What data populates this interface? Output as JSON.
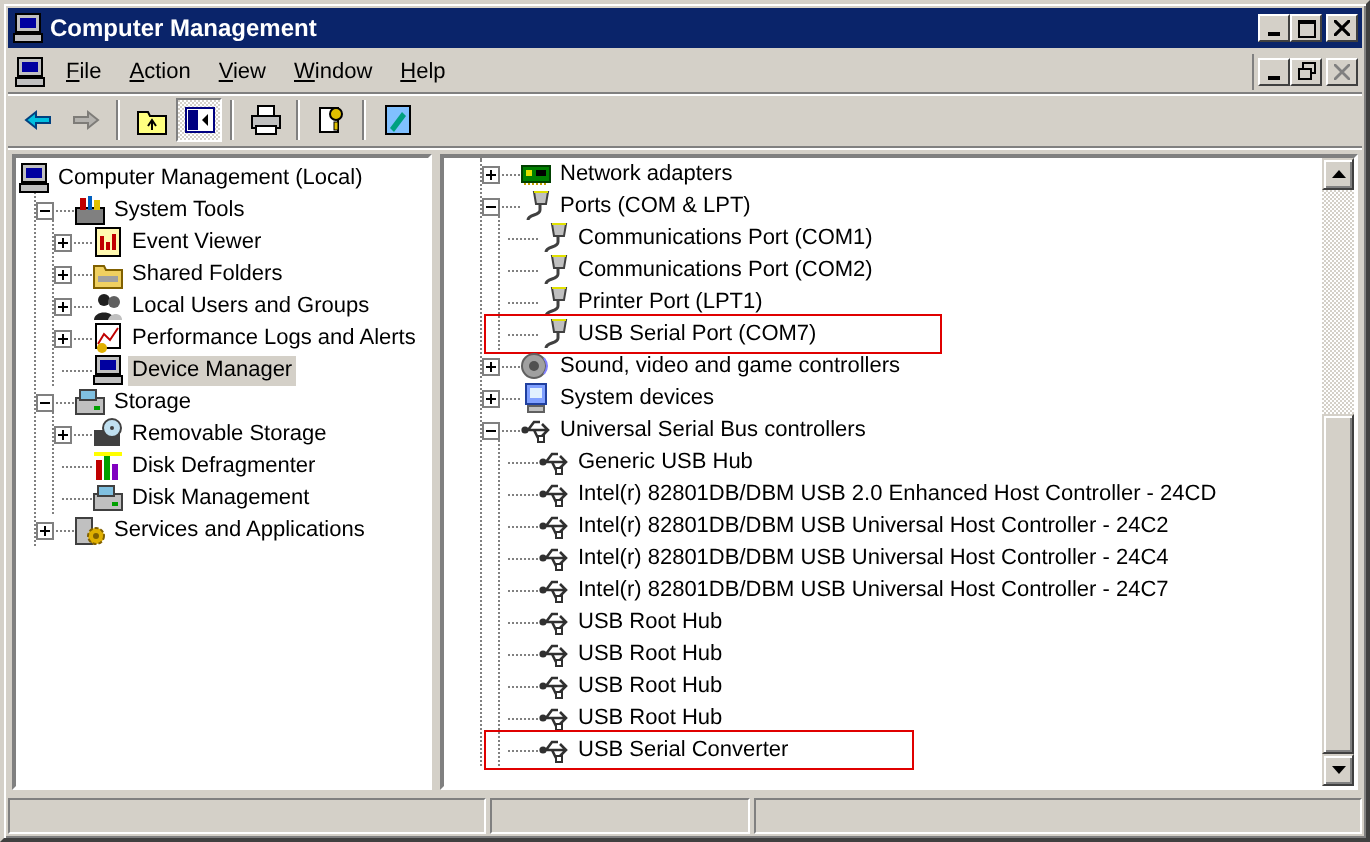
{
  "window": {
    "title": "Computer Management"
  },
  "menu": [
    {
      "label": "File"
    },
    {
      "label": "Action"
    },
    {
      "label": "View"
    },
    {
      "label": "Window"
    },
    {
      "label": "Help"
    }
  ],
  "toolbar": [
    {
      "kind": "back",
      "disabled": false,
      "pressed": false
    },
    {
      "kind": "forward",
      "disabled": true,
      "pressed": false
    },
    {
      "kind": "separator"
    },
    {
      "kind": "up",
      "disabled": false,
      "pressed": false
    },
    {
      "kind": "tree",
      "disabled": false,
      "pressed": true
    },
    {
      "kind": "separator"
    },
    {
      "kind": "print",
      "disabled": false,
      "pressed": false
    },
    {
      "kind": "separator"
    },
    {
      "kind": "help",
      "disabled": false,
      "pressed": false
    },
    {
      "kind": "separator"
    },
    {
      "kind": "console",
      "disabled": false,
      "pressed": false
    }
  ],
  "left_tree": {
    "items": [
      {
        "label": "Computer Management (Local)",
        "kind": "computer",
        "selected": false,
        "children": [
          {
            "label": "System Tools",
            "kind": "tools",
            "expanded": true,
            "selected": false,
            "children": [
              {
                "label": "Event Viewer",
                "kind": "log",
                "expanded": false,
                "selected": false
              },
              {
                "label": "Shared Folders",
                "kind": "folder",
                "expanded": false,
                "selected": false
              },
              {
                "label": "Local Users and Groups",
                "kind": "users",
                "expanded": false,
                "selected": false
              },
              {
                "label": "Performance Logs and Alerts",
                "kind": "chart",
                "expanded": false,
                "selected": false
              },
              {
                "label": "Device Manager",
                "kind": "computer",
                "selected": true
              }
            ]
          },
          {
            "label": "Storage",
            "kind": "drive",
            "expanded": true,
            "selected": false,
            "children": [
              {
                "label": "Removable Storage",
                "kind": "disc",
                "expanded": false,
                "selected": false
              },
              {
                "label": "Disk Defragmenter",
                "kind": "bars",
                "selected": false
              },
              {
                "label": "Disk Management",
                "kind": "drive",
                "selected": false
              }
            ]
          },
          {
            "label": "Services and Applications",
            "kind": "gear",
            "expanded": false,
            "selected": false
          }
        ]
      }
    ]
  },
  "right_tree": {
    "items": [
      {
        "label": "Network adapters",
        "kind": "card",
        "expanded": false,
        "selected": false,
        "highlighted": false
      },
      {
        "label": "Ports (COM & LPT)",
        "kind": "plug",
        "expanded": true,
        "selected": false,
        "highlighted": false,
        "children": [
          {
            "label": "Communications Port (COM1)",
            "kind": "plug",
            "selected": false,
            "highlighted": false
          },
          {
            "label": "Communications Port (COM2)",
            "kind": "plug",
            "selected": false,
            "highlighted": false
          },
          {
            "label": "Printer Port (LPT1)",
            "kind": "plug",
            "selected": false,
            "highlighted": false
          },
          {
            "label": "USB Serial Port (COM7)",
            "kind": "plug",
            "selected": false,
            "highlighted": true
          }
        ]
      },
      {
        "label": "Sound, video and game controllers",
        "kind": "speaker",
        "expanded": false,
        "selected": false,
        "highlighted": false
      },
      {
        "label": "System devices",
        "kind": "monitor",
        "expanded": false,
        "selected": false,
        "highlighted": false
      },
      {
        "label": "Universal Serial Bus controllers",
        "kind": "usb",
        "expanded": true,
        "selected": false,
        "highlighted": false,
        "children": [
          {
            "label": "Generic USB Hub",
            "kind": "usb",
            "selected": false,
            "highlighted": false
          },
          {
            "label": "Intel(r) 82801DB/DBM USB 2.0 Enhanced Host Controller - 24CD",
            "kind": "usb",
            "selected": false,
            "highlighted": false
          },
          {
            "label": "Intel(r) 82801DB/DBM USB Universal Host Controller - 24C2",
            "kind": "usb",
            "selected": false,
            "highlighted": false
          },
          {
            "label": "Intel(r) 82801DB/DBM USB Universal Host Controller - 24C4",
            "kind": "usb",
            "selected": false,
            "highlighted": false
          },
          {
            "label": "Intel(r) 82801DB/DBM USB Universal Host Controller - 24C7",
            "kind": "usb",
            "selected": false,
            "highlighted": false
          },
          {
            "label": "USB Root Hub",
            "kind": "usb",
            "selected": false,
            "highlighted": false
          },
          {
            "label": "USB Root Hub",
            "kind": "usb",
            "selected": false,
            "highlighted": false
          },
          {
            "label": "USB Root Hub",
            "kind": "usb",
            "selected": false,
            "highlighted": false
          },
          {
            "label": "USB Root Hub",
            "kind": "usb",
            "selected": false,
            "highlighted": false
          },
          {
            "label": "USB Serial Converter",
            "kind": "usb",
            "selected": false,
            "highlighted": true
          }
        ]
      }
    ]
  }
}
